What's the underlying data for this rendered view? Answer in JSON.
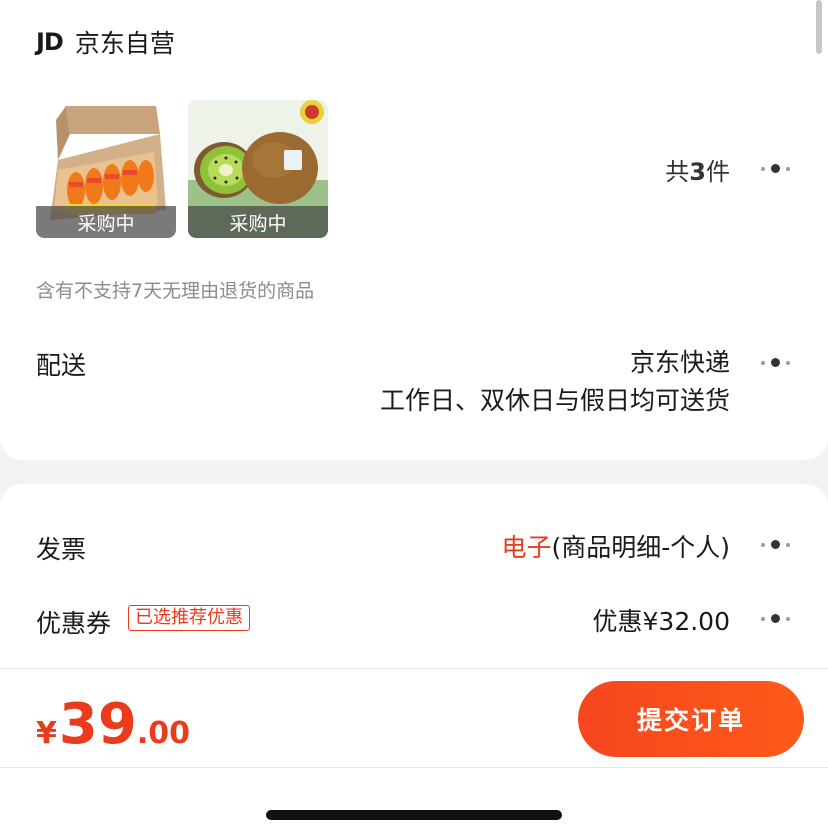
{
  "store": {
    "logo": "JD",
    "name": "京东自营"
  },
  "products": [
    {
      "badge": "采购中",
      "icon": "boxed-fruit-image"
    },
    {
      "badge": "采购中",
      "icon": "kiwi-fruit-image"
    }
  ],
  "summary": {
    "prefix": "共",
    "count": "3",
    "suffix": "件"
  },
  "notice": "含有不支持7天无理由退货的商品",
  "delivery": {
    "label": "配送",
    "method": "京东快递",
    "schedule": "工作日、双休日与假日均可送货"
  },
  "invoice": {
    "label": "发票",
    "type": "电子",
    "detail": "(商品明细-个人)"
  },
  "coupon": {
    "label": "优惠券",
    "tag": "已选推荐优惠",
    "value": "优惠¥32.00"
  },
  "footer": {
    "currency": "¥",
    "price_int": "39",
    "price_dec": ".00",
    "submit_label": "提交订单"
  },
  "colors": {
    "accent": "#ea3b1c",
    "button": "#f5461e"
  }
}
